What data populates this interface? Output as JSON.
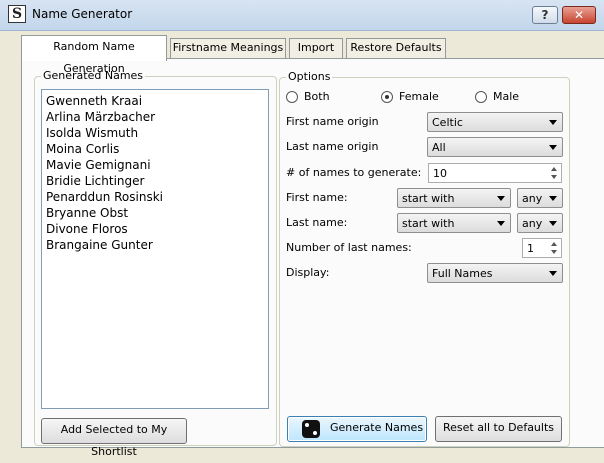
{
  "window": {
    "title": "Name Generator",
    "help": "?",
    "close": "✕",
    "app_icon": "S"
  },
  "tabs": [
    {
      "label": "Random Name Generation",
      "active": true
    },
    {
      "label": "Firstname Meanings"
    },
    {
      "label": "Import"
    },
    {
      "label": "Restore Defaults"
    }
  ],
  "generated": {
    "title": "Generated Names",
    "names": [
      "Gwenneth Kraai",
      "Arlina Märzbacher",
      "Isolda Wismuth",
      "Moina Corlis",
      "Mavie Gemignani",
      "Bridie Lichtinger",
      "Penarddun Rosinski",
      "Bryanne Obst",
      "Divone Floros",
      "Brangaine Gunter"
    ],
    "shortlist_button": "Add Selected to My Shortlist"
  },
  "options": {
    "title": "Options",
    "gender": {
      "both": "Both",
      "female": "Female",
      "male": "Male",
      "selected": "Female"
    },
    "first_origin": {
      "label": "First name origin",
      "value": "Celtic"
    },
    "last_origin": {
      "label": "Last name origin",
      "value": "All"
    },
    "count": {
      "label": "# of names to generate:",
      "value": "10"
    },
    "first_name": {
      "label": "First name:",
      "mode": "start with",
      "letter": "any"
    },
    "last_name": {
      "label": "Last name:",
      "mode": "start with",
      "letter": "any"
    },
    "num_last": {
      "label": "Number of last names:",
      "value": "1"
    },
    "display": {
      "label": "Display:",
      "value": "Full Names"
    }
  },
  "actions": {
    "generate": "Generate Names",
    "reset": "Reset all to Defaults"
  }
}
